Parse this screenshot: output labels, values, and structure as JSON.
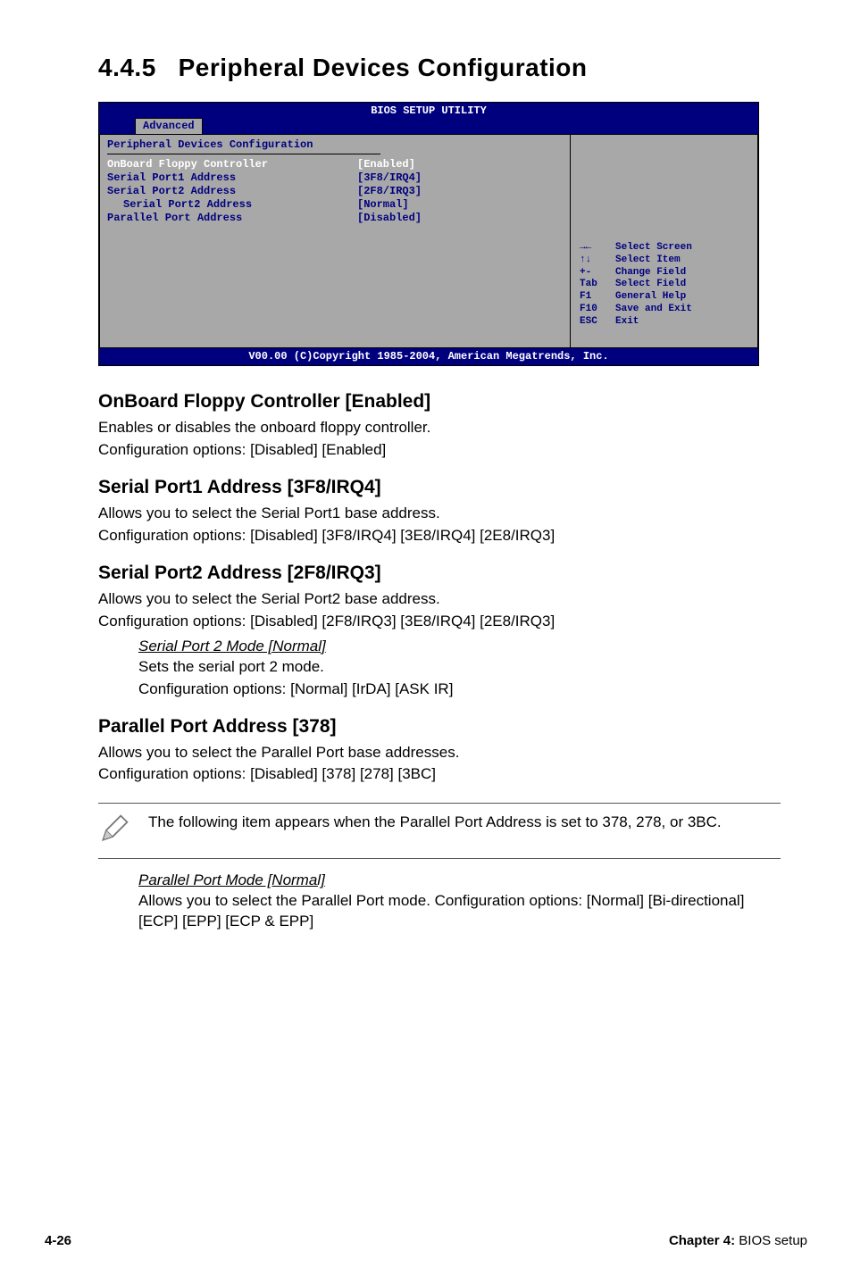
{
  "section": {
    "number": "4.4.5",
    "title": "Peripheral Devices Configuration"
  },
  "bios": {
    "header": "BIOS SETUP UTILITY",
    "tab": "Advanced",
    "panel_title": "Peripheral Devices Configuration",
    "options": [
      {
        "label": "OnBoard Floppy Controller",
        "value": "[Enabled]",
        "indent": false
      },
      {
        "label": "Serial Port1 Address",
        "value": "[3F8/IRQ4]",
        "indent": false
      },
      {
        "label": "Serial Port2 Address",
        "value": "[2F8/IRQ3]",
        "indent": false
      },
      {
        "label": "Serial Port2 Address",
        "value": "[Normal]",
        "indent": true
      },
      {
        "label": "Parallel Port Address",
        "value": "[Disabled]",
        "indent": false
      }
    ],
    "help": [
      {
        "key": "→←",
        "desc": "Select Screen"
      },
      {
        "key": "↑↓",
        "desc": "Select Item"
      },
      {
        "key": "+-",
        "desc": "Change Field"
      },
      {
        "key": "Tab",
        "desc": "Select Field"
      },
      {
        "key": "F1",
        "desc": "General Help"
      },
      {
        "key": "F10",
        "desc": "Save and Exit"
      },
      {
        "key": "ESC",
        "desc": "Exit"
      }
    ],
    "footer": "V00.00 (C)Copyright 1985-2004, American Megatrends, Inc."
  },
  "items": {
    "onboard_floppy": {
      "title": "OnBoard Floppy Controller [Enabled]",
      "line1": "Enables or disables the onboard floppy controller.",
      "line2": "Configuration options: [Disabled] [Enabled]"
    },
    "serial1": {
      "title": "Serial Port1 Address [3F8/IRQ4]",
      "line1": "Allows you to select the Serial Port1 base address.",
      "line2": "Configuration options: [Disabled] [3F8/IRQ4] [3E8/IRQ4] [2E8/IRQ3]"
    },
    "serial2": {
      "title": "Serial Port2 Address [2F8/IRQ3]",
      "line1": "Allows you to select the Serial Port2 base address.",
      "line2": "Configuration options: [Disabled] [2F8/IRQ3] [3E8/IRQ4] [2E8/IRQ3]",
      "sub_title": "Serial Port 2 Mode [Normal]",
      "sub_line1": "Sets the serial port 2 mode.",
      "sub_line2": "Configuration options: [Normal] [IrDA] [ASK IR]"
    },
    "parallel": {
      "title": "Parallel Port Address [378]",
      "line1": "Allows you to select the Parallel Port base addresses.",
      "line2": "Configuration options: [Disabled] [378] [278] [3BC]",
      "note": "The following item appears when the Parallel Port Address is set to 378, 278, or 3BC.",
      "sub_title": "Parallel Port Mode [Normal]",
      "sub_line1": "Allows you to select the Parallel Port  mode. Configuration options: [Normal] [Bi-directional] [ECP] [EPP] [ECP & EPP]"
    }
  },
  "footer": {
    "page": "4-26",
    "chapter_bold": "Chapter 4:",
    "chapter_rest": " BIOS setup"
  }
}
